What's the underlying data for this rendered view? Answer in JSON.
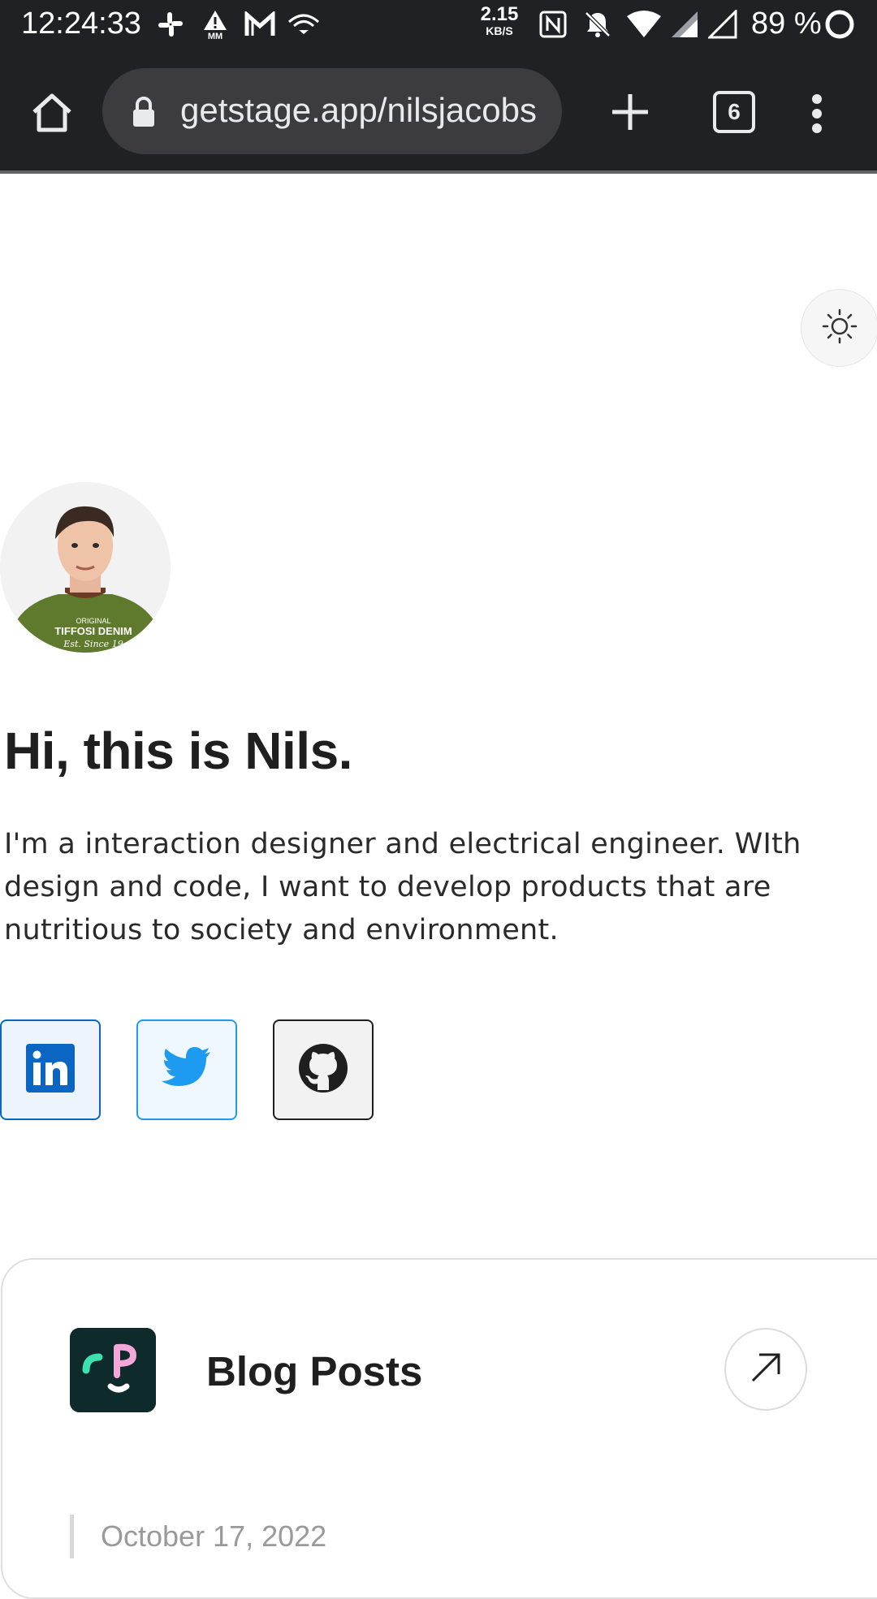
{
  "status_bar": {
    "time": "12:24:33",
    "net_speed_value": "2.15",
    "net_speed_unit": "KB/S",
    "battery": "89 %",
    "icons": [
      "slack-icon",
      "drive-warning-icon",
      "gmail-icon",
      "cast-icon",
      "nfc-icon",
      "bell-off-icon",
      "wifi-icon",
      "signal-icon",
      "signal-empty-icon",
      "battery-ring-icon"
    ]
  },
  "browser": {
    "url": "getstage.app/nilsjacobs",
    "tab_count": "6"
  },
  "profile": {
    "headline": "Hi, this is Nils.",
    "bio": "I'm a interaction designer and electrical engineer. WIth design and code, I want to develop products that are nutritious to society and environment.",
    "shirt_text_small": "ORIGINAL",
    "shirt_text_main": "TIFFOSI DENIM",
    "shirt_text_script": "Est. Since 19"
  },
  "social": [
    {
      "name": "linkedin",
      "color": "#0a66c2"
    },
    {
      "name": "twitter",
      "color": "#1d9bf0"
    },
    {
      "name": "github",
      "color": "#1f1f1f"
    }
  ],
  "blog_card": {
    "title": "Blog Posts",
    "first_post_date": "October 17, 2022"
  },
  "colors": {
    "chrome_bg": "#202124",
    "page_bg": "#ffffff",
    "logo_bg": "#0e2a2a"
  }
}
